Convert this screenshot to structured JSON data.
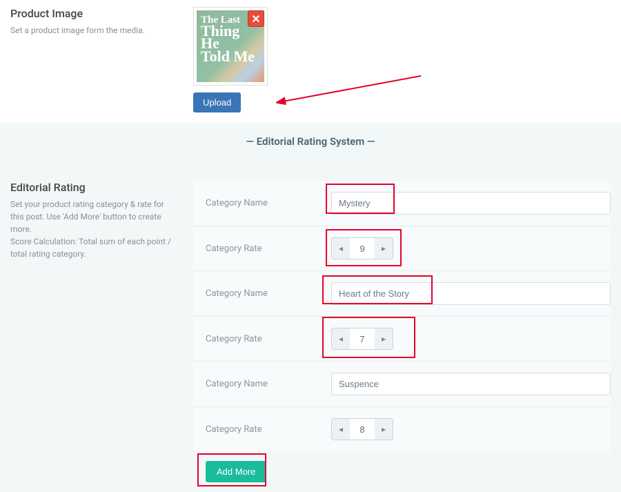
{
  "productImage": {
    "heading": "Product Image",
    "description": "Set a product image form the media.",
    "uploadLabel": "Upload"
  },
  "editorialSystem": {
    "titleBar": "— Editorial Rating System —"
  },
  "editorialRating": {
    "heading": "Editorial Rating",
    "description": "Set your product rating category & rate for this post. Use 'Add More' button to create more.\nScore Calculation: Total sum of each point / total rating category.",
    "categoryNameLabel": "Category Name",
    "categoryRateLabel": "Category Rate",
    "rows": [
      {
        "name": "Mystery",
        "rate": "9"
      },
      {
        "name": "Heart of the Story",
        "rate": "7"
      },
      {
        "name": "Suspence",
        "rate": "8"
      }
    ],
    "addMoreLabel": "Add More"
  }
}
